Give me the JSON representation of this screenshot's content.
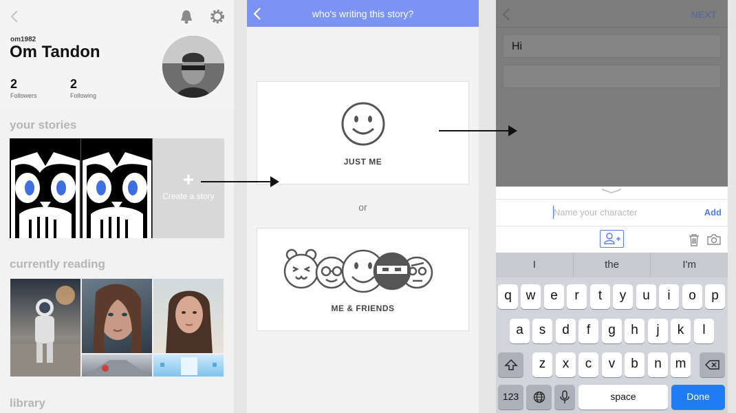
{
  "profile": {
    "handle": "om1982",
    "name": "Om Tandon",
    "followers_count": "2",
    "followers_label": "Followers",
    "following_count": "2",
    "following_label": "Following",
    "your_stories_title": "your stories",
    "create_story_label": "Create a story",
    "currently_reading_title": "currently reading",
    "library_title": "library"
  },
  "writer_select": {
    "header_title": "who's writing this story?",
    "option_just_me": "JUST ME",
    "or_label": "or",
    "option_friends": "ME & FRIENDS",
    "header_color": "#7b93f3"
  },
  "character": {
    "next_label": "NEXT",
    "story_text": "Hi",
    "name_placeholder": "Name your character",
    "add_label": "Add"
  },
  "keyboard": {
    "suggestions": [
      "I",
      "the",
      "I'm"
    ],
    "row1": [
      "q",
      "w",
      "e",
      "r",
      "t",
      "y",
      "u",
      "i",
      "o",
      "p"
    ],
    "row2": [
      "a",
      "s",
      "d",
      "f",
      "g",
      "h",
      "j",
      "k",
      "l"
    ],
    "row3": [
      "z",
      "x",
      "c",
      "v",
      "b",
      "n",
      "m"
    ],
    "numbers_label": "123",
    "space_label": "space",
    "done_label": "Done",
    "accent_color": "#1f7cf4"
  }
}
